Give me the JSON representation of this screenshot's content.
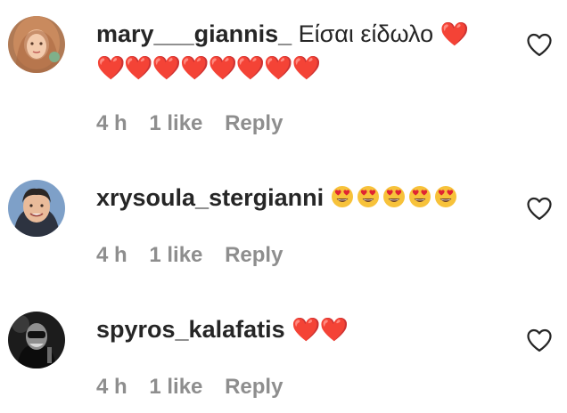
{
  "comments": [
    {
      "username": "mary___giannis_",
      "text": "Είσαι είδωλο",
      "emoji_line1": "❤️",
      "emoji_line2": "❤️❤️❤️❤️❤️❤️❤️❤️",
      "time": "4 h",
      "likes": "1 like",
      "reply": "Reply"
    },
    {
      "username": "xrysoula_stergianni",
      "text": "",
      "emoji_count": 5,
      "emoji_name": "heart-eyes-emoji",
      "time": "4 h",
      "likes": "1 like",
      "reply": "Reply"
    },
    {
      "username": "spyros_kalafatis",
      "text": "",
      "emoji_line1": "❤️❤️",
      "time": "4 h",
      "likes": "1 like",
      "reply": "Reply"
    }
  ],
  "icons": {
    "like": "heart-outline-icon"
  },
  "colors": {
    "text": "#262626",
    "meta": "#8e8e8e",
    "heart": "#e0202a"
  }
}
